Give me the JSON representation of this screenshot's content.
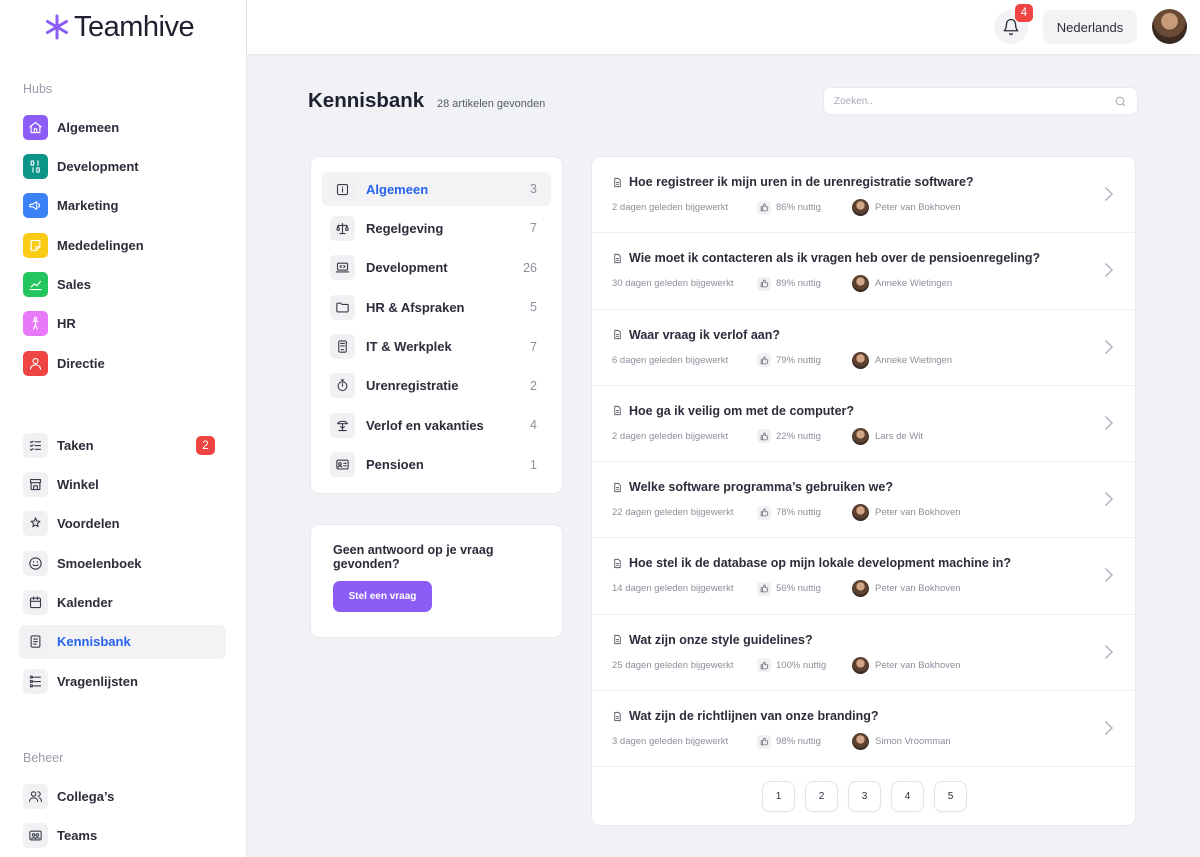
{
  "app": {
    "name": "Teamhive",
    "accent": "#8b5cf6",
    "link": "#2563eb"
  },
  "sidebar": {
    "hubs_title": "Hubs",
    "hubs": [
      {
        "label": "Algemeen",
        "icon": "home-icon",
        "color": "#8b5cf6"
      },
      {
        "label": "Development",
        "icon": "binary-icon",
        "color": "#0d9488"
      },
      {
        "label": "Marketing",
        "icon": "megaphone-icon",
        "color": "#3b82f6"
      },
      {
        "label": "Mededelingen",
        "icon": "note-icon",
        "color": "#facc15"
      },
      {
        "label": "Sales",
        "icon": "chart-icon",
        "color": "#22c55e"
      },
      {
        "label": "HR",
        "icon": "person-icon",
        "color": "#e879f9"
      },
      {
        "label": "Directie",
        "icon": "user-icon",
        "color": "#ef4444"
      }
    ],
    "tools": [
      {
        "label": "Taken",
        "icon": "checklist-icon",
        "badge": "2"
      },
      {
        "label": "Winkel",
        "icon": "store-icon"
      },
      {
        "label": "Voordelen",
        "icon": "stars-icon"
      },
      {
        "label": "Smoelenboek",
        "icon": "smile-icon"
      },
      {
        "label": "Kalender",
        "icon": "calendar-icon"
      },
      {
        "label": "Kennisbank",
        "icon": "book-icon",
        "active": true
      },
      {
        "label": "Vragenlijsten",
        "icon": "list-icon"
      }
    ],
    "admin_title": "Beheer",
    "admin": [
      {
        "label": "Collega’s",
        "icon": "users-icon"
      },
      {
        "label": "Teams",
        "icon": "team-icon"
      }
    ]
  },
  "topbar": {
    "notifications": "4",
    "language": "Nederlands"
  },
  "page": {
    "title": "Kennisbank",
    "count": "28 artikelen gevonden",
    "search_placeholder": "Zoeken.."
  },
  "categories": [
    {
      "name": "Algemeen",
      "count": "3",
      "icon": "info-icon",
      "active": true
    },
    {
      "name": "Regelgeving",
      "count": "7",
      "icon": "scale-icon"
    },
    {
      "name": "Development",
      "count": "26",
      "icon": "laptop-code-icon"
    },
    {
      "name": "HR & Afspraken",
      "count": "5",
      "icon": "folder-icon"
    },
    {
      "name": "IT & Werkplek",
      "count": "7",
      "icon": "device-icon"
    },
    {
      "name": "Urenregistratie",
      "count": "2",
      "icon": "stopwatch-icon"
    },
    {
      "name": "Verlof en vakanties",
      "count": "4",
      "icon": "beach-icon"
    },
    {
      "name": "Pensioen",
      "count": "1",
      "icon": "pension-icon"
    }
  ],
  "ask": {
    "text": "Geen antwoord op je vraag gevonden?",
    "button": "Stel een vraag"
  },
  "articles": [
    {
      "title": "Hoe registreer ik mijn uren in de urenregistratie software?",
      "updated": "2 dagen geleden bijgewerkt",
      "useful": "86% nuttig",
      "author": "Peter van Bokhoven"
    },
    {
      "title": "Wie moet ik contacteren als ik vragen heb over de pensioenregeling?",
      "updated": "30 dagen geleden bijgewerkt",
      "useful": "89% nuttig",
      "author": "Anneke Wietingen"
    },
    {
      "title": "Waar vraag ik verlof aan?",
      "updated": "6 dagen geleden bijgewerkt",
      "useful": "79% nuttig",
      "author": "Anneke Wietingen"
    },
    {
      "title": "Hoe ga ik veilig om met de computer?",
      "updated": "2 dagen geleden bijgewerkt",
      "useful": "22% nuttig",
      "author": "Lars de Wit"
    },
    {
      "title": "Welke software programma’s gebruiken we?",
      "updated": "22 dagen geleden bijgewerkt",
      "useful": "78% nuttig",
      "author": "Peter van Bokhoven"
    },
    {
      "title": "Hoe stel ik de database op mijn lokale development machine in?",
      "updated": "14 dagen geleden bijgewerkt",
      "useful": "56% nuttig",
      "author": "Peter van Bokhoven"
    },
    {
      "title": "Wat zijn onze style guidelines?",
      "updated": "25 dagen geleden bijgewerkt",
      "useful": "100% nuttig",
      "author": "Peter van Bokhoven"
    },
    {
      "title": "Wat zijn de richtlijnen van onze branding?",
      "updated": "3 dagen geleden bijgewerkt",
      "useful": "98% nuttig",
      "author": "Simon Vroomman"
    }
  ],
  "pagination": [
    "1",
    "2",
    "3",
    "4",
    "5"
  ]
}
